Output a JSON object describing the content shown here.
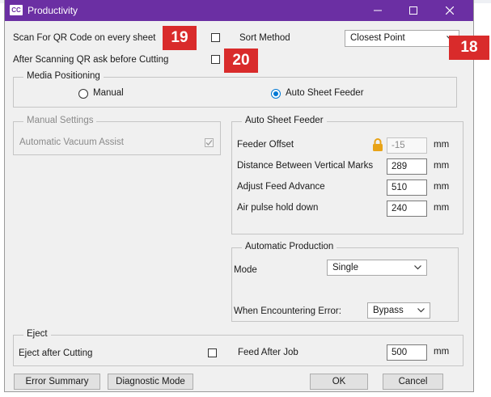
{
  "window": {
    "title": "Productivity",
    "logo": "CC"
  },
  "callouts": [
    "19",
    "20",
    "18"
  ],
  "top_options": {
    "scan_qr": {
      "label": "Scan For QR Code on every sheet",
      "checked": false
    },
    "ask_before_cutting": {
      "label": "After Scanning QR ask before Cutting",
      "checked": false
    },
    "sort_method_label": "Sort Method",
    "sort_method_value": "Closest Point"
  },
  "media_positioning": {
    "title": "Media Positioning",
    "options": [
      {
        "label": "Manual",
        "checked": false
      },
      {
        "label": "Auto Sheet Feeder",
        "checked": true
      }
    ]
  },
  "manual_settings": {
    "title": "Manual Settings",
    "vacuum_label": "Automatic Vacuum Assist",
    "vacuum_checked": true
  },
  "auto_sheet_feeder": {
    "title": "Auto Sheet Feeder",
    "unit": "mm",
    "fields": [
      {
        "label": "Feeder Offset",
        "value": "-15",
        "locked": true,
        "disabled": true
      },
      {
        "label": "Distance Between Vertical Marks",
        "value": "289",
        "locked": false,
        "disabled": false
      },
      {
        "label": "Adjust Feed Advance",
        "value": "510",
        "locked": false,
        "disabled": false
      },
      {
        "label": "Air pulse hold down",
        "value": "240",
        "locked": false,
        "disabled": false
      }
    ]
  },
  "automatic_production": {
    "title": "Automatic Production",
    "mode_label": "Mode",
    "mode_value": "Single",
    "error_label": "When Encountering Error:",
    "error_value": "Bypass"
  },
  "eject": {
    "title": "Eject",
    "eject_label": "Eject after Cutting",
    "eject_checked": false,
    "feed_label": "Feed After Job",
    "feed_value": "500",
    "unit": "mm"
  },
  "buttons": {
    "error_summary": "Error Summary",
    "diagnostic_mode": "Diagnostic Mode",
    "ok": "OK",
    "cancel": "Cancel"
  },
  "icons": {
    "minimize": "minimize-icon",
    "maximize": "maximize-icon",
    "close": "close-icon",
    "lock": "padlock-icon",
    "chevron": "chevron-down-icon"
  },
  "colors": {
    "title_bar": "#6b2fa3",
    "accent": "#0078d4",
    "callout": "#d92b2b",
    "border": "#c5c5c5",
    "window": "#f0f0f0",
    "lock": "#e8a317"
  }
}
